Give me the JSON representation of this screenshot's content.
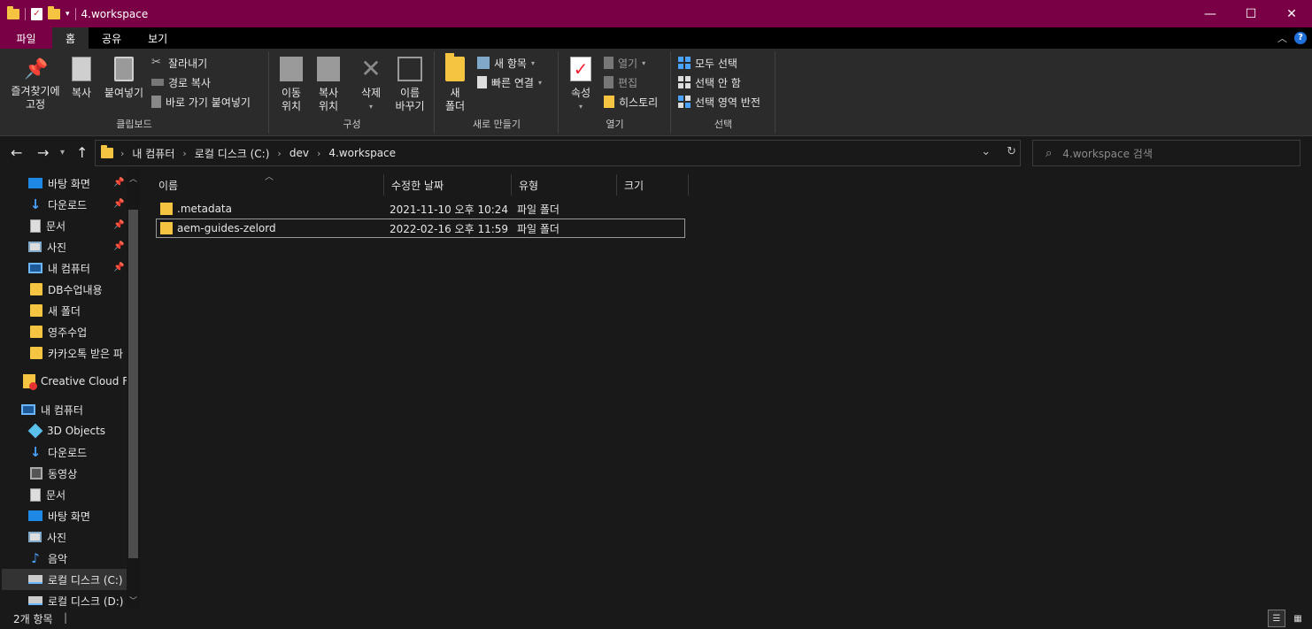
{
  "window": {
    "title": "4.workspace",
    "accent": "#7a0046",
    "controls": [
      "minimize",
      "maximize",
      "close"
    ]
  },
  "ribbon_tabs": [
    "파일",
    "홈",
    "공유",
    "보기"
  ],
  "ribbon": {
    "clipboard": {
      "label": "클립보드",
      "pin": "즐겨찾기에\n고정",
      "copy": "복사",
      "paste": "붙여넣기",
      "cut": "잘라내기",
      "copy_path": "경로 복사",
      "paste_shortcut": "바로 가기 붙여넣기"
    },
    "organize": {
      "label": "구성",
      "move_to": "이동\n위치",
      "copy_to": "복사\n위치",
      "delete": "삭제",
      "rename": "이름\n바꾸기"
    },
    "new": {
      "label": "새로 만들기",
      "new_folder": "새\n폴더",
      "new_item": "새 항목",
      "easy_access": "빠른 연결"
    },
    "open": {
      "label": "열기",
      "properties": "속성",
      "open": "열기",
      "edit": "편집",
      "history": "히스토리"
    },
    "select": {
      "label": "선택",
      "select_all": "모두 선택",
      "select_none": "선택 안 함",
      "invert": "선택 영역 반전"
    }
  },
  "address": {
    "crumbs": [
      "내 컴퓨터",
      "로컬 디스크 (C:)",
      "dev",
      "4.workspace"
    ],
    "search_placeholder": "4.workspace 검색"
  },
  "nav_pane": {
    "quick_access": [
      {
        "label": "바탕 화면",
        "icon": "desktop-icon",
        "pinned": true
      },
      {
        "label": "다운로드",
        "icon": "download-icon",
        "pinned": true
      },
      {
        "label": "문서",
        "icon": "document-icon",
        "pinned": true
      },
      {
        "label": "사진",
        "icon": "pictures-icon",
        "pinned": true
      },
      {
        "label": "내 컴퓨터",
        "icon": "computer-icon",
        "pinned": true
      },
      {
        "label": "DB수업내용",
        "icon": "folder-icon",
        "pinned": false
      },
      {
        "label": "새 폴더",
        "icon": "folder-icon",
        "pinned": false
      },
      {
        "label": "영주수업",
        "icon": "folder-icon",
        "pinned": false
      },
      {
        "label": "카카오톡 받은 파",
        "icon": "folder-icon",
        "pinned": false
      }
    ],
    "creative_cloud": "Creative Cloud Fil",
    "this_pc": "내 컴퓨터",
    "pc_items": [
      {
        "label": "3D Objects",
        "icon": "3d-objects-icon"
      },
      {
        "label": "다운로드",
        "icon": "download-icon"
      },
      {
        "label": "동영상",
        "icon": "video-icon"
      },
      {
        "label": "문서",
        "icon": "document-icon"
      },
      {
        "label": "바탕 화면",
        "icon": "desktop-icon"
      },
      {
        "label": "사진",
        "icon": "pictures-icon"
      },
      {
        "label": "음악",
        "icon": "music-icon"
      },
      {
        "label": "로컬 디스크 (C:)",
        "icon": "drive-icon"
      },
      {
        "label": "로컬 디스크 (D:)",
        "icon": "drive-icon"
      }
    ]
  },
  "columns": [
    "이름",
    "수정한 날짜",
    "유형",
    "크기"
  ],
  "files": [
    {
      "name": ".metadata",
      "modified": "2021-11-10 오후 10:24",
      "type": "파일 폴더",
      "size": ""
    },
    {
      "name": "aem-guides-zelord",
      "modified": "2022-02-16 오후 11:59",
      "type": "파일 폴더",
      "size": ""
    }
  ],
  "status": {
    "item_count": "2개 항목"
  }
}
